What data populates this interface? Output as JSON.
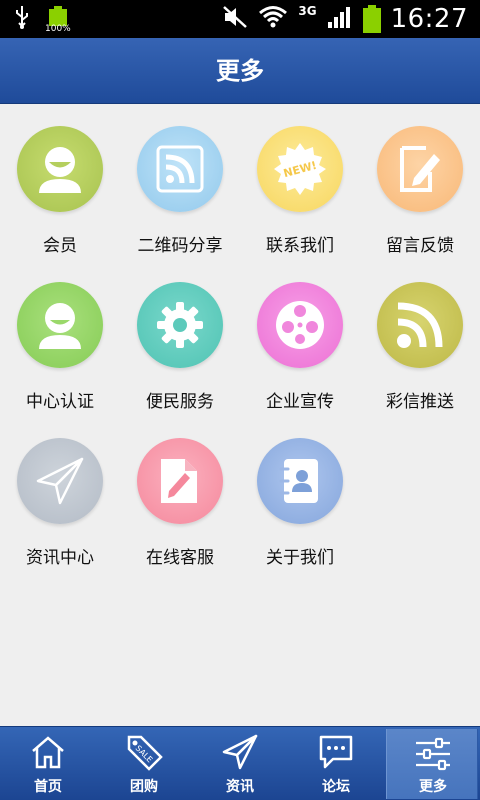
{
  "status_bar": {
    "battery_small_label": "100%",
    "network": "3G",
    "time": "16:27"
  },
  "header": {
    "title": "更多"
  },
  "colors": {
    "header": "#2a57a8",
    "tabbar": "#2a57a8",
    "background": "#efefef"
  },
  "grid": {
    "items": [
      {
        "label": "会员",
        "icon": "member-icon",
        "color": "#b5cf5e"
      },
      {
        "label": "二维码分享",
        "icon": "rss-share-icon",
        "color": "#a7d6f2"
      },
      {
        "label": "联系我们",
        "icon": "new-badge-icon",
        "color": "#fbe07a"
      },
      {
        "label": "留言反馈",
        "icon": "note-pencil-icon",
        "color": "#fcc58a"
      },
      {
        "label": "中心认证",
        "icon": "person-badge-icon",
        "color": "#9ad86a"
      },
      {
        "label": "便民服务",
        "icon": "gear-icon",
        "color": "#66cfc1"
      },
      {
        "label": "企业宣传",
        "icon": "film-reel-icon",
        "color": "#f487e0"
      },
      {
        "label": "彩信推送",
        "icon": "rss-icon",
        "color": "#c8c45a"
      },
      {
        "label": "资讯中心",
        "icon": "paper-plane-icon",
        "color": "#c2c9d2"
      },
      {
        "label": "在线客服",
        "icon": "document-pencil-icon",
        "color": "#f89cae"
      },
      {
        "label": "关于我们",
        "icon": "address-book-icon",
        "color": "#9db8e6"
      }
    ]
  },
  "tabbar": {
    "tabs": [
      {
        "label": "首页",
        "icon": "home-icon"
      },
      {
        "label": "团购",
        "icon": "sale-tag-icon"
      },
      {
        "label": "资讯",
        "icon": "paper-plane-icon"
      },
      {
        "label": "论坛",
        "icon": "chat-bubble-icon"
      },
      {
        "label": "更多",
        "icon": "sliders-icon",
        "active": true
      }
    ]
  }
}
